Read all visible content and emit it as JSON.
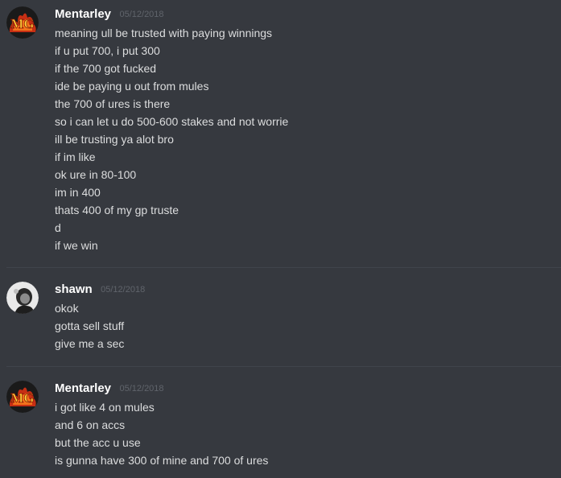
{
  "channel": {
    "groups": [
      {
        "author": "Mentarley",
        "timestamp": "05/12/2018",
        "avatar_icon": "mg-logo-avatar",
        "lines": [
          "meaning ull be trusted with paying winnings",
          "if u put 700, i put 300",
          "if the 700 got fucked",
          "ide be paying u out from mules",
          "the 700 of ures is there",
          "so i can let u do 500-600 stakes and not worrie",
          "ill be trusting ya alot bro",
          "if im like",
          "ok ure in 80-100",
          "im in 400",
          "thats 400 of my gp truste",
          "d",
          "if we win"
        ]
      },
      {
        "author": "shawn",
        "timestamp": "05/12/2018",
        "avatar_icon": "shawn-photo-avatar",
        "lines": [
          "okok",
          "gotta sell stuff",
          "give me a sec"
        ]
      },
      {
        "author": "Mentarley",
        "timestamp": "05/12/2018",
        "avatar_icon": "mg-logo-avatar",
        "lines": [
          "i got like 4 on mules",
          "and 6 on accs",
          "but the acc u use",
          "is gunna have 300 of mine and 700 of ures"
        ]
      }
    ]
  },
  "colors": {
    "background": "#36393f",
    "username": "#ffffff",
    "message_text": "#dcddde",
    "timestamp": "#60646b",
    "divider": "#40444b"
  }
}
